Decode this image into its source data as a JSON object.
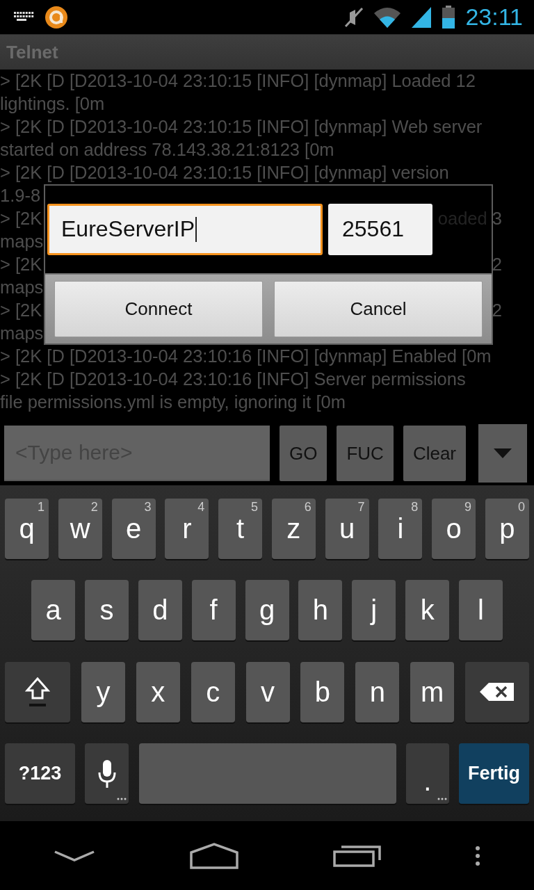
{
  "status_bar": {
    "time": "23:11"
  },
  "title": "Telnet",
  "log": [
    {
      "text": "> [2K [D [D2013-10-04 23:10:15 [INFO] [dynmap] Loaded 12"
    },
    {
      "text": "lightings. [0m"
    },
    {
      "text": "> [2K [D [D2013-10-04 23:10:15 [INFO] [dynmap] Web server"
    },
    {
      "text": "started on address 78.143.38.21:8123 [0m"
    },
    {
      "text": "> [2K [D [D2013-10-04 23:10:15 [INFO] [dynmap] version"
    },
    {
      "text": "1.9-8"
    },
    {
      "text": "> [2K",
      "tail": "oaded 3"
    },
    {
      "text": "maps"
    },
    {
      "text": "> [2K",
      "tail": "2"
    },
    {
      "text": "maps"
    },
    {
      "text": "> [2K",
      "tail": "2"
    },
    {
      "text": "maps"
    },
    {
      "text": "> [2K [D [D2013-10-04 23:10:16 [INFO] [dynmap] Enabled [0m"
    },
    {
      "text": "> [2K [D [D2013-10-04 23:10:16 [INFO] Server permissions"
    },
    {
      "text": "file permissions.yml is empty, ignoring it [0m"
    }
  ],
  "dialog": {
    "host": {
      "value": "EureServerIP",
      "focused": true
    },
    "port": {
      "value": "25561",
      "focused": false
    },
    "buttons": [
      "Connect",
      "Cancel"
    ]
  },
  "command_bar": {
    "placeholder": "<Type here>",
    "buttons": [
      "GO",
      "FUC",
      "Clear"
    ]
  },
  "keyboard": {
    "rows": [
      {
        "keys": [
          {
            "kind": "letter",
            "label": "q",
            "hint": "1"
          },
          {
            "kind": "letter",
            "label": "w",
            "hint": "2"
          },
          {
            "kind": "letter",
            "label": "e",
            "hint": "3"
          },
          {
            "kind": "letter",
            "label": "r",
            "hint": "4"
          },
          {
            "kind": "letter",
            "label": "t",
            "hint": "5"
          },
          {
            "kind": "letter",
            "label": "z",
            "hint": "6"
          },
          {
            "kind": "letter",
            "label": "u",
            "hint": "7"
          },
          {
            "kind": "letter",
            "label": "i",
            "hint": "8"
          },
          {
            "kind": "letter",
            "label": "o",
            "hint": "9"
          },
          {
            "kind": "letter",
            "label": "p",
            "hint": "0"
          }
        ]
      },
      {
        "keys": [
          {
            "kind": "letter",
            "label": "a"
          },
          {
            "kind": "letter",
            "label": "s"
          },
          {
            "kind": "letter",
            "label": "d"
          },
          {
            "kind": "letter",
            "label": "f"
          },
          {
            "kind": "letter",
            "label": "g"
          },
          {
            "kind": "letter",
            "label": "h"
          },
          {
            "kind": "letter",
            "label": "j"
          },
          {
            "kind": "letter",
            "label": "k"
          },
          {
            "kind": "letter",
            "label": "l"
          }
        ]
      },
      {
        "keys": [
          {
            "kind": "shift"
          },
          {
            "kind": "letter",
            "label": "y"
          },
          {
            "kind": "letter",
            "label": "x"
          },
          {
            "kind": "letter",
            "label": "c"
          },
          {
            "kind": "letter",
            "label": "v"
          },
          {
            "kind": "letter",
            "label": "b"
          },
          {
            "kind": "letter",
            "label": "n"
          },
          {
            "kind": "letter",
            "label": "m"
          },
          {
            "kind": "backspace"
          }
        ]
      },
      {
        "keys": [
          {
            "kind": "symbols",
            "label": "?123"
          },
          {
            "kind": "mic"
          },
          {
            "kind": "space"
          },
          {
            "kind": "period",
            "label": "."
          },
          {
            "kind": "action",
            "label": "Fertig"
          }
        ]
      }
    ]
  }
}
